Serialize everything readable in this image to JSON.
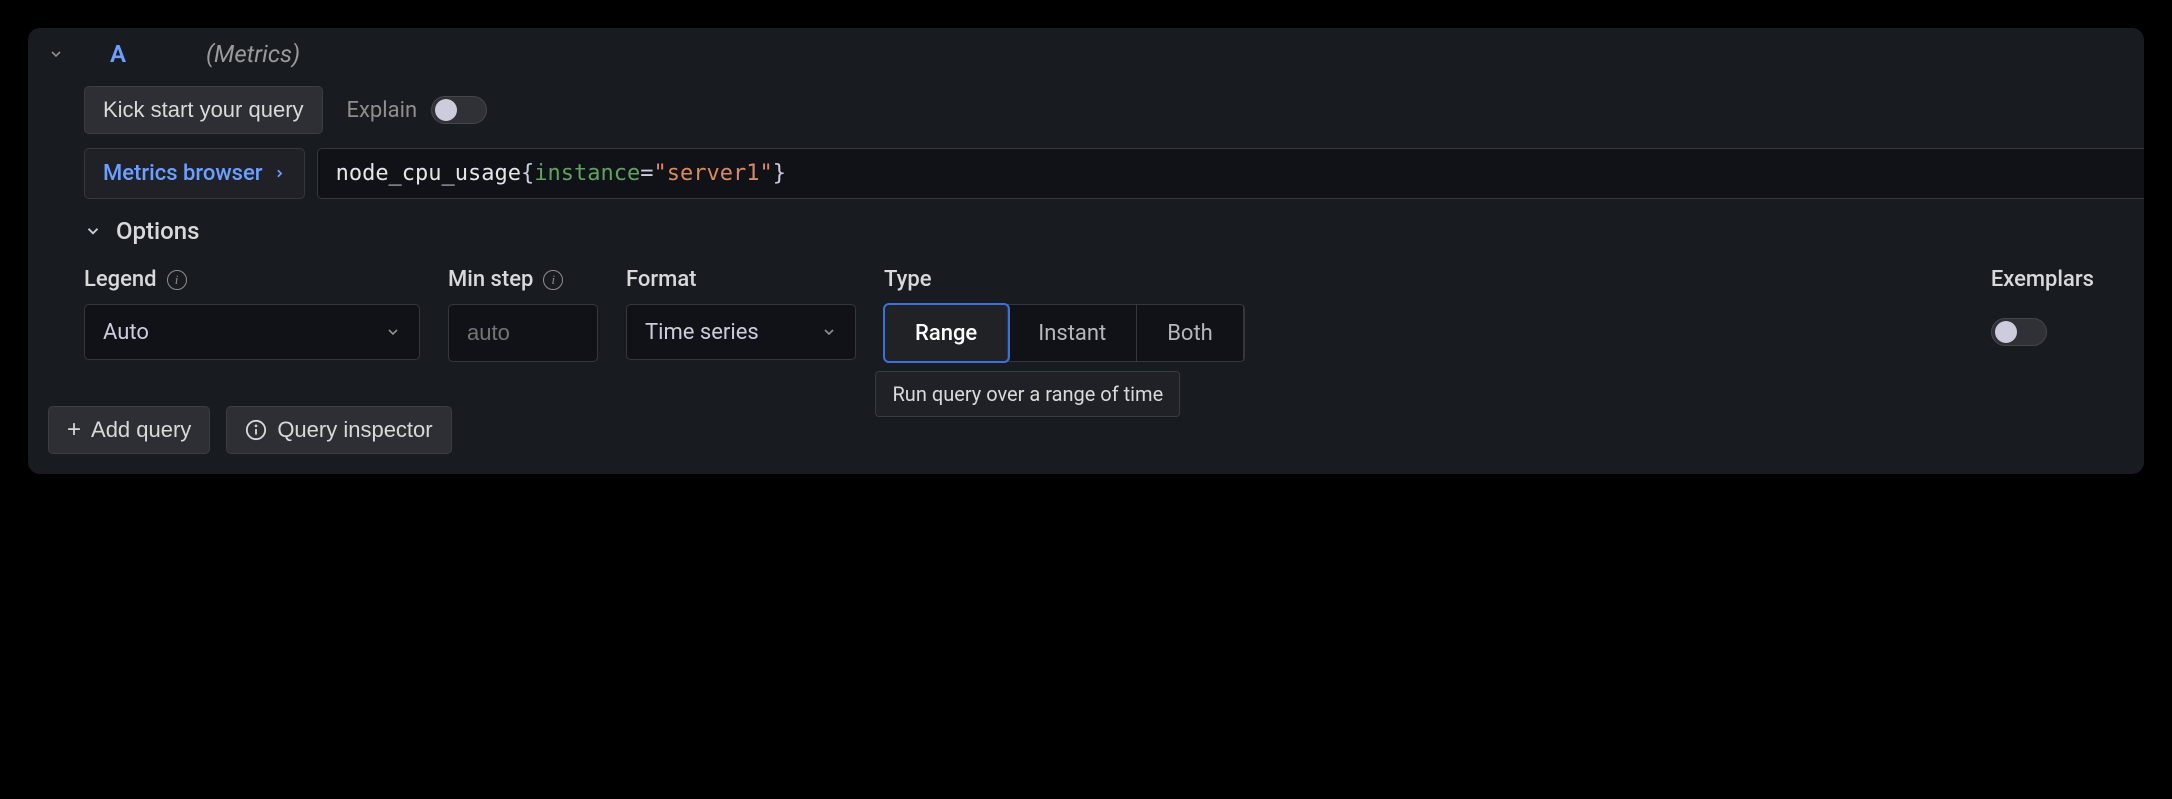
{
  "header": {
    "letter": "A",
    "hint": "(Metrics)"
  },
  "toolbar": {
    "kickstart_label": "Kick start your query",
    "explain_label": "Explain"
  },
  "query": {
    "metrics_browser_label": "Metrics browser",
    "expression": {
      "metric": "node_cpu_usage",
      "label_key": "instance",
      "label_value": "\"server1\""
    }
  },
  "options": {
    "section_title": "Options",
    "legend": {
      "label": "Legend",
      "value": "Auto"
    },
    "minstep": {
      "label": "Min step",
      "placeholder": "auto"
    },
    "format": {
      "label": "Format",
      "value": "Time series"
    },
    "type": {
      "label": "Type",
      "options": [
        "Range",
        "Instant",
        "Both"
      ],
      "selected": "Range",
      "tooltip": "Run query over a range of time"
    },
    "exemplars": {
      "label": "Exemplars"
    }
  },
  "footer": {
    "add_query_label": "Add query",
    "inspector_label": "Query inspector"
  }
}
